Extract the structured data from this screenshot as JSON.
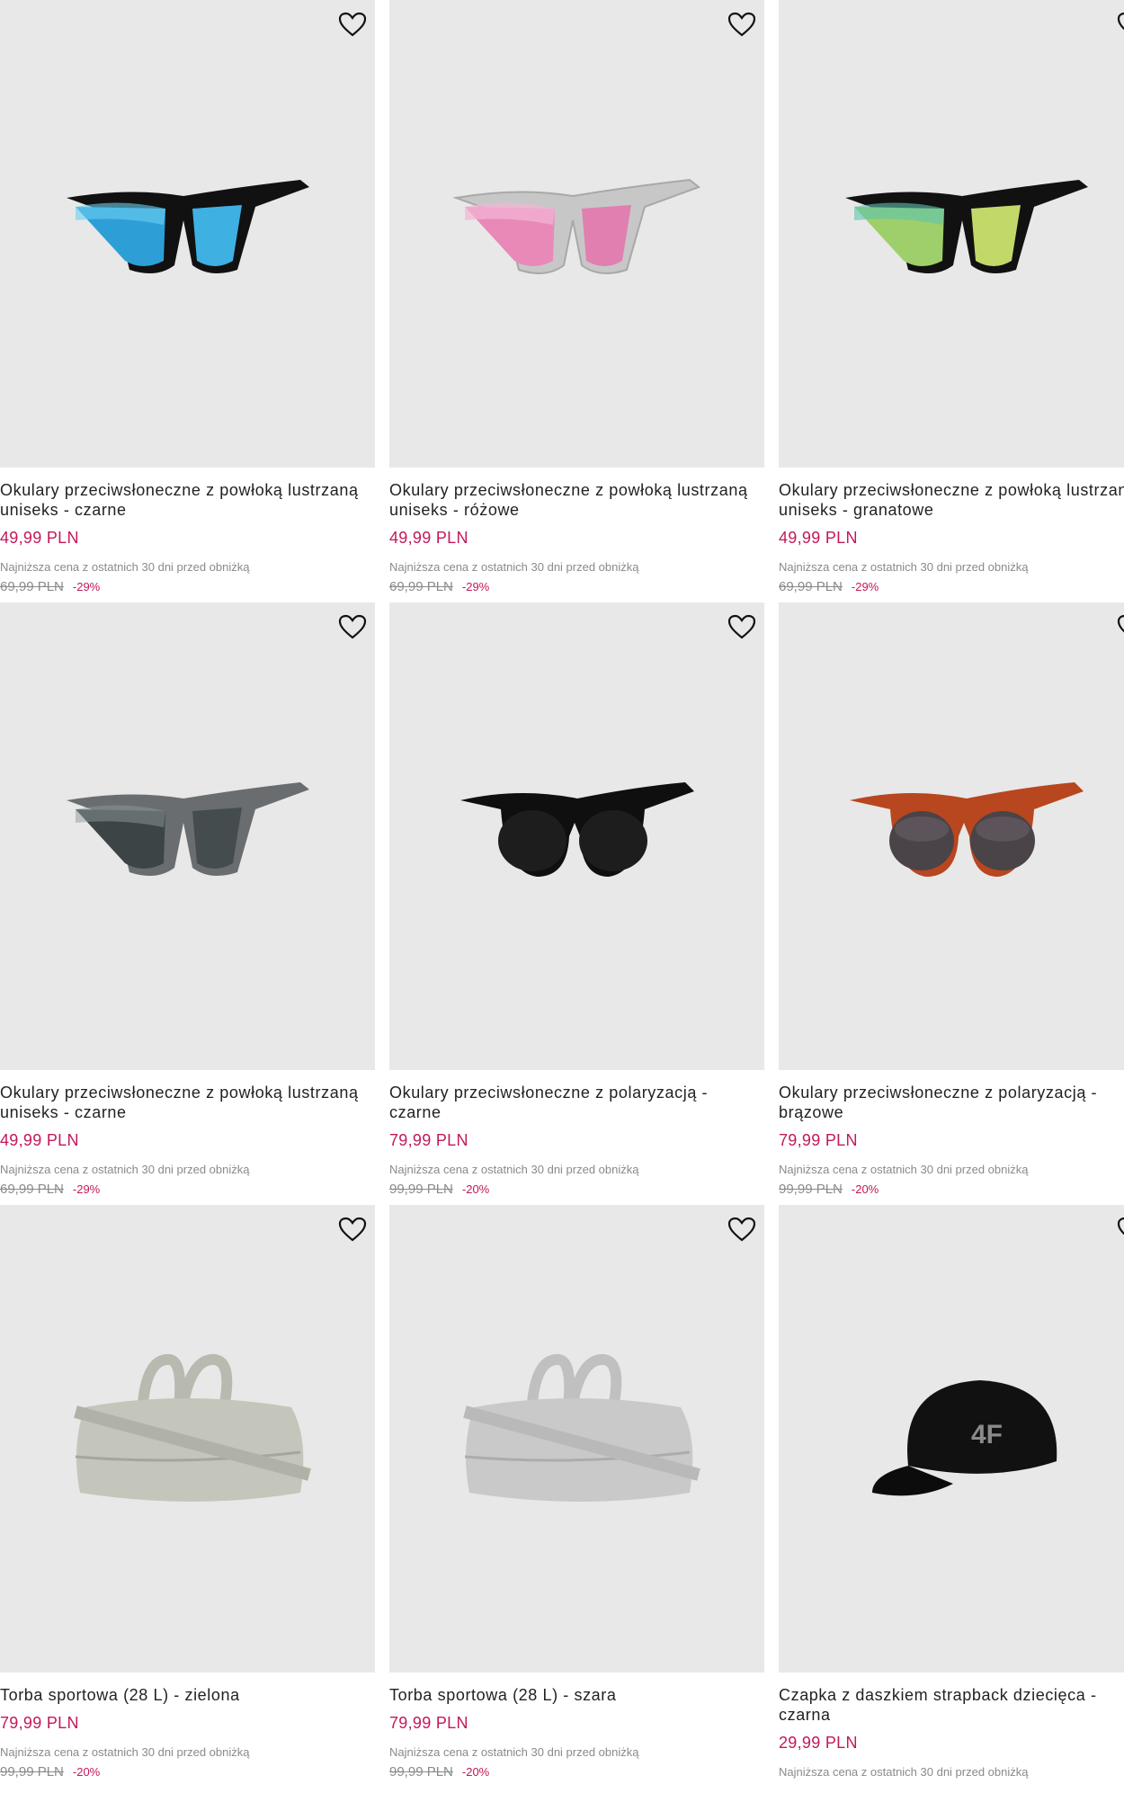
{
  "colors": {
    "accent": "#c2185b",
    "image_bg": "#e8e8e8",
    "muted": "#8a8a8a"
  },
  "products": [
    {
      "title": "Okulary przeciwsłoneczne z powłoką lustrzaną uniseks - czarne",
      "price": "49,99 PLN",
      "lowest_note": "Najniższa cena z ostatnich 30 dni przed obniżką",
      "old_price": "69,99 PLN",
      "discount": "-29%",
      "image": "sunglasses-black-blue-lens"
    },
    {
      "title": "Okulary przeciwsłoneczne z powłoką lustrzaną uniseks - różowe",
      "price": "49,99 PLN",
      "lowest_note": "Najniższa cena z ostatnich 30 dni przed obniżką",
      "old_price": "69,99 PLN",
      "discount": "-29%",
      "image": "sunglasses-clear-pink-lens"
    },
    {
      "title": "Okulary przeciwsłoneczne z powłoką lustrzaną uniseks - granatowe",
      "price": "49,99 PLN",
      "lowest_note": "Najniższa cena z ostatnich 30 dni przed obniżką",
      "old_price": "69,99 PLN",
      "discount": "-29%",
      "image": "sunglasses-black-green-lens"
    },
    {
      "title": "Okulary przeciwsłoneczne z powłoką lustrzaną uniseks - czarne",
      "price": "49,99 PLN",
      "lowest_note": "Najniższa cena z ostatnich 30 dni przed obniżką",
      "old_price": "69,99 PLN",
      "discount": "-29%",
      "image": "sunglasses-grey"
    },
    {
      "title": "Okulary przeciwsłoneczne z polaryzacją - czarne",
      "price": "79,99 PLN",
      "lowest_note": "Najniższa cena z ostatnich 30 dni przed obniżką",
      "old_price": "99,99 PLN",
      "discount": "-20%",
      "image": "sunglasses-round-black"
    },
    {
      "title": "Okulary przeciwsłoneczne z polaryzacją - brązowe",
      "price": "79,99 PLN",
      "lowest_note": "Najniższa cena z ostatnich 30 dni przed obniżką",
      "old_price": "99,99 PLN",
      "discount": "-20%",
      "image": "sunglasses-round-brown"
    },
    {
      "title": "Torba sportowa (28 L) - zielona",
      "price": "79,99 PLN",
      "lowest_note": "Najniższa cena z ostatnich 30 dni przed obniżką",
      "old_price": "99,99 PLN",
      "discount": "-20%",
      "image": "bag-green"
    },
    {
      "title": "Torba sportowa (28 L) - szara",
      "price": "79,99 PLN",
      "lowest_note": "Najniższa cena z ostatnich 30 dni przed obniżką",
      "old_price": "99,99 PLN",
      "discount": "-20%",
      "image": "bag-grey"
    },
    {
      "title": "Czapka z daszkiem strapback dziecięca - czarna",
      "price": "29,99 PLN",
      "lowest_note": "Najniższa cena z ostatnich 30 dni przed obniżką",
      "old_price": "",
      "discount": "",
      "image": "cap-black-4f"
    }
  ]
}
